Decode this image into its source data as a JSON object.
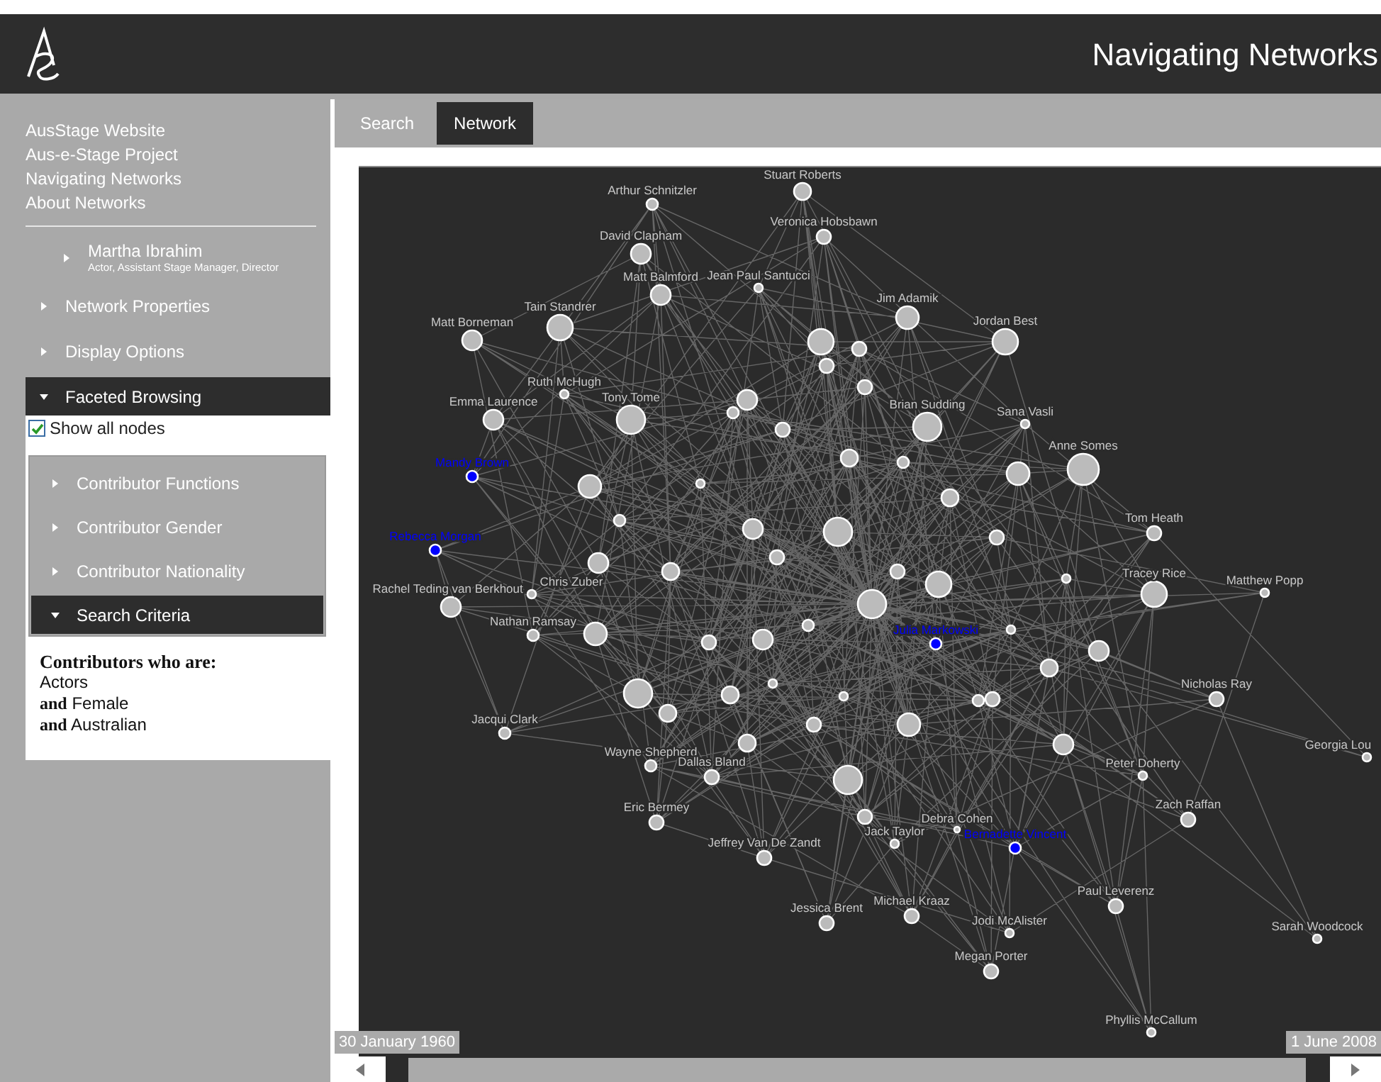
{
  "header": {
    "title": "Navigating Networks"
  },
  "sidebar": {
    "links": [
      {
        "label": "AusStage Website"
      },
      {
        "label": "Aus-e-Stage Project"
      },
      {
        "label": "Navigating Networks"
      },
      {
        "label": "About Networks"
      }
    ],
    "contributor": {
      "name": "Martha Ibrahim",
      "roles": "Actor, Assistant Stage Manager, Director",
      "expanded": false
    },
    "sections": [
      {
        "label": "Network Properties",
        "expanded": false
      },
      {
        "label": "Display Options",
        "expanded": false
      },
      {
        "label": "Faceted Browsing",
        "expanded": true
      }
    ],
    "show_all_nodes": {
      "label": "Show all nodes",
      "checked": true
    },
    "facets": [
      {
        "label": "Contributor Functions",
        "expanded": false
      },
      {
        "label": "Contributor Gender",
        "expanded": false
      },
      {
        "label": "Contributor Nationality",
        "expanded": false
      },
      {
        "label": "Search Criteria",
        "expanded": true
      }
    ],
    "criteria": {
      "heading": "Contributors who are:",
      "lines": [
        "Actors",
        "**and** Female",
        "**and** Australian"
      ]
    }
  },
  "tabs": [
    {
      "label": "Search",
      "selected": false
    },
    {
      "label": "Network",
      "selected": true
    }
  ],
  "network": {
    "nodes": [
      {
        "label": "Arthur Schnitzler",
        "highlighted": false
      },
      {
        "label": "Stuart Roberts",
        "highlighted": false
      },
      {
        "label": "Veronica Hobsbawn",
        "highlighted": false
      },
      {
        "label": "David Clapham",
        "highlighted": false
      },
      {
        "label": "Matt Balmford",
        "highlighted": false
      },
      {
        "label": "Jean Paul Santucci",
        "highlighted": false
      },
      {
        "label": "Tain Standrer",
        "highlighted": false
      },
      {
        "label": "Matt Borneman",
        "highlighted": false
      },
      {
        "label": "Jim Adamik",
        "highlighted": false
      },
      {
        "label": "Jordan Best",
        "highlighted": false
      },
      {
        "label": "Ruth McHugh",
        "highlighted": false
      },
      {
        "label": "Tony Tome",
        "highlighted": false
      },
      {
        "label": "Emma Laurence",
        "highlighted": false
      },
      {
        "label": "Brian Sudding",
        "highlighted": false
      },
      {
        "label": "Sana Vasli",
        "highlighted": false
      },
      {
        "label": "Anne Somes",
        "highlighted": false
      },
      {
        "label": "Mandy Brown",
        "highlighted": true
      },
      {
        "label": "Rebecca Morgan",
        "highlighted": true
      },
      {
        "label": "Tom Heath",
        "highlighted": false
      },
      {
        "label": "Tracey Rice",
        "highlighted": false
      },
      {
        "label": "Matthew Popp",
        "highlighted": false
      },
      {
        "label": "Rachel Teding van Berkhout",
        "highlighted": false
      },
      {
        "label": "Chris Zuber",
        "highlighted": false
      },
      {
        "label": "Nathan Ramsay",
        "highlighted": false
      },
      {
        "label": "Julia Markowski",
        "highlighted": true
      },
      {
        "label": "Jacqui Clark",
        "highlighted": false
      },
      {
        "label": "Wayne Shepherd",
        "highlighted": false
      },
      {
        "label": "Dallas Bland",
        "highlighted": false
      },
      {
        "label": "Eric Bermey",
        "highlighted": false
      },
      {
        "label": "Nicholas Ray",
        "highlighted": false
      },
      {
        "label": "Georgia Lou",
        "highlighted": false
      },
      {
        "label": "Peter Doherty",
        "highlighted": false
      },
      {
        "label": "Zach Raffan",
        "highlighted": false
      },
      {
        "label": "Jack Taylor",
        "highlighted": false
      },
      {
        "label": "Debra Cohen",
        "highlighted": false
      },
      {
        "label": "Bernadette Vincent",
        "highlighted": true
      },
      {
        "label": "Jeffrey Van De Zandt",
        "highlighted": false
      },
      {
        "label": "Jessica Brent",
        "highlighted": false
      },
      {
        "label": "Michael Kraaz",
        "highlighted": false
      },
      {
        "label": "Paul Leverenz",
        "highlighted": false
      },
      {
        "label": "Jodi McAlister",
        "highlighted": false
      },
      {
        "label": "Sarah Woodcock",
        "highlighted": false
      },
      {
        "label": "Megan Porter",
        "highlighted": false
      },
      {
        "label": "Phyllis McCallum",
        "highlighted": false
      }
    ]
  },
  "timeline": {
    "start": "30 January 1960",
    "end": "1 June 2008"
  }
}
